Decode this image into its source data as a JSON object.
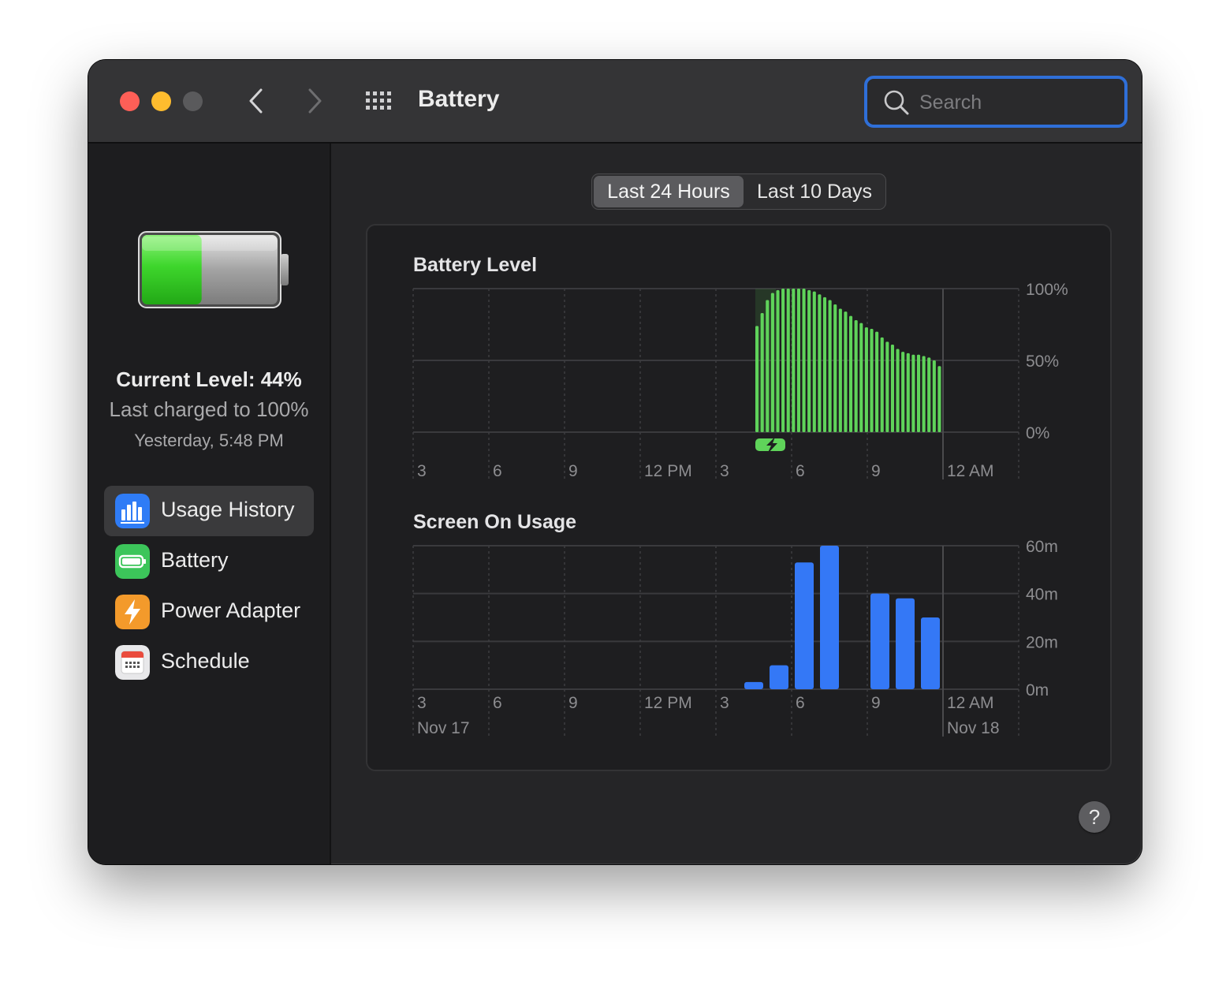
{
  "window": {
    "title": "Battery",
    "search_placeholder": "Search"
  },
  "sidebar": {
    "current_level": "Current Level: 44%",
    "last_charged": "Last charged to 100%",
    "charged_time": "Yesterday, 5:48 PM",
    "battery_fill_fraction": 0.44,
    "items": [
      {
        "label": "Usage History",
        "icon": "bar-chart-icon",
        "color": "#2f7cf6",
        "selected": true
      },
      {
        "label": "Battery",
        "icon": "battery-icon",
        "color": "#3cc55a",
        "selected": false
      },
      {
        "label": "Power Adapter",
        "icon": "lightning-icon",
        "color": "#f39a2b",
        "selected": false
      },
      {
        "label": "Schedule",
        "icon": "calendar-icon",
        "color": "#e8e8ea",
        "selected": false
      }
    ]
  },
  "segmented": {
    "options": [
      "Last 24 Hours",
      "Last 10 Days"
    ],
    "selected": "Last 24 Hours"
  },
  "help_label": "?",
  "chart_data": [
    {
      "type": "bar",
      "title": "Battery Level",
      "color": "#5fd35a",
      "x_ticks": [
        "3",
        "6",
        "9",
        "12 PM",
        "3",
        "6",
        "9",
        "12 AM"
      ],
      "y_ticks": [
        "100%",
        "50%",
        "0%"
      ],
      "ylim": [
        0,
        100
      ],
      "grid": true,
      "charging_marker": "charging-bolt-icon",
      "values": [
        74,
        83,
        92,
        97,
        99,
        100,
        100,
        100,
        100,
        100,
        99,
        98,
        96,
        94,
        92,
        89,
        86,
        84,
        81,
        78,
        76,
        73,
        72,
        70,
        66,
        63,
        61,
        58,
        56,
        55,
        54,
        54,
        53,
        52,
        50,
        46
      ]
    },
    {
      "type": "bar",
      "title": "Screen On Usage",
      "color": "#3478f6",
      "x_ticks": [
        "3",
        "6",
        "9",
        "12 PM",
        "3",
        "6",
        "9",
        "12 AM"
      ],
      "date_labels": [
        "Nov 17",
        "Nov 18"
      ],
      "y_ticks": [
        "60m",
        "40m",
        "20m",
        "0m"
      ],
      "ylim": [
        0,
        60
      ],
      "grid": true,
      "values": [
        0,
        0,
        0,
        0,
        0,
        0,
        0,
        0,
        0,
        0,
        0,
        0,
        0,
        3,
        10,
        53,
        60,
        0,
        40,
        38,
        30,
        0,
        0,
        0
      ]
    }
  ]
}
